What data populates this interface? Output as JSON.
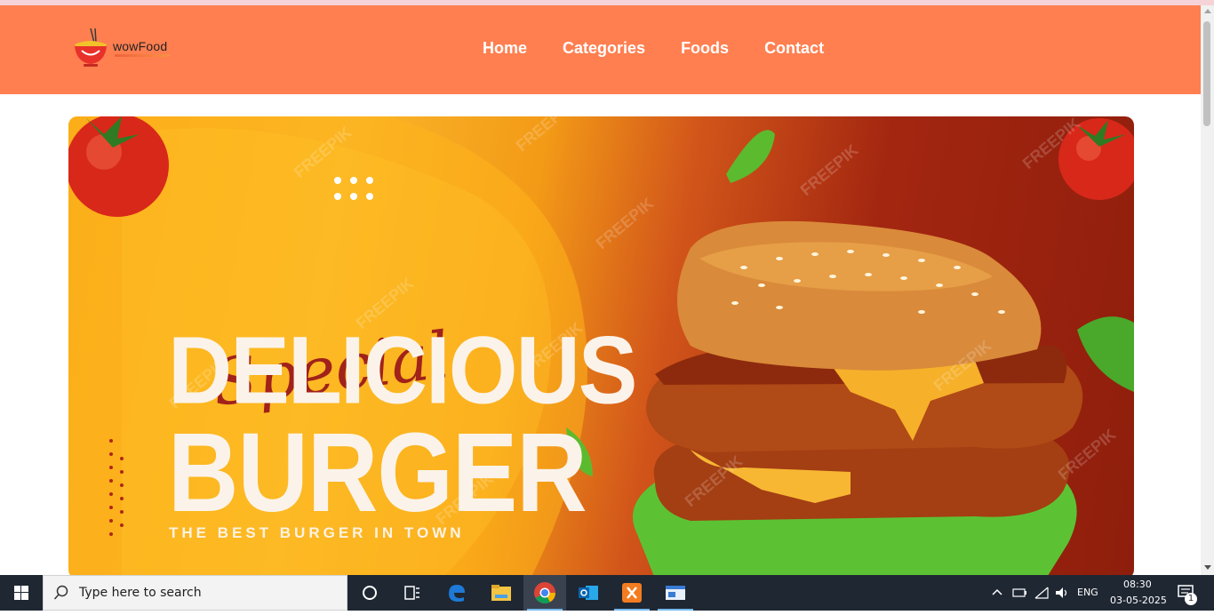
{
  "site": {
    "logo_name": "wowFood",
    "nav": [
      "Home",
      "Categories",
      "Foods",
      "Contact"
    ]
  },
  "hero": {
    "script_word": "Special",
    "headline_1": "DELICIOUS",
    "headline_2": "BURGER",
    "tagline": "THE BEST BURGER IN TOWN",
    "watermark": "FREEPIK"
  },
  "colors": {
    "navbar": "#ff7f50",
    "nav_text": "#ffffff",
    "hero_left": "#f7a716",
    "hero_right": "#8e1e0c"
  },
  "taskbar": {
    "search_placeholder": "Type here to search",
    "apps": [
      "cortana-icon",
      "task-view-icon",
      "edge-icon",
      "file-explorer-icon",
      "chrome-icon",
      "outlook-icon",
      "xampp-icon",
      "notepad-icon"
    ],
    "language": "ENG",
    "time": "08:30",
    "date": "03-05-2025",
    "notifications": "1"
  }
}
